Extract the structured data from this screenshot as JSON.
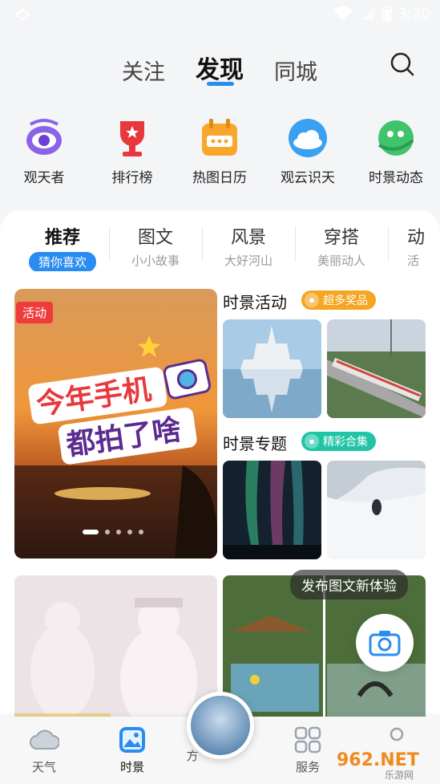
{
  "status_bar": {
    "time": "3:20"
  },
  "top_tabs": {
    "follow": "关注",
    "discover": "发现",
    "local": "同城"
  },
  "quick_links": [
    "观天者",
    "排行榜",
    "热图日历",
    "观云识天",
    "时景动态"
  ],
  "categories": [
    {
      "title": "推荐",
      "sub": "猜你喜欢"
    },
    {
      "title": "图文",
      "sub": "小小故事"
    },
    {
      "title": "风景",
      "sub": "大好河山"
    },
    {
      "title": "穿搭",
      "sub": "美丽动人"
    },
    {
      "title": "动",
      "sub": "活"
    }
  ],
  "banner": {
    "badge": "活动",
    "line1": "今年手机",
    "line2": "都拍了啥",
    "dots": 5,
    "active_dot": 0
  },
  "sections": {
    "activity_title": "时景活动",
    "activity_pill": "超多奖品",
    "topic_title": "时景专题",
    "topic_pill": "精彩合集"
  },
  "fab": {
    "bubble": "发布图文新体验"
  },
  "bottom_nav": {
    "weather": "天气",
    "shijing": "时景",
    "partial": "方",
    "service": "服务"
  },
  "watermark": {
    "brand": "962.NET",
    "sub": "乐游网"
  },
  "colors": {
    "accent": "#2a8cf0",
    "badge_red": "#ef3b3b",
    "pill_orange": "#f5a623",
    "pill_teal": "#21c5a6"
  }
}
